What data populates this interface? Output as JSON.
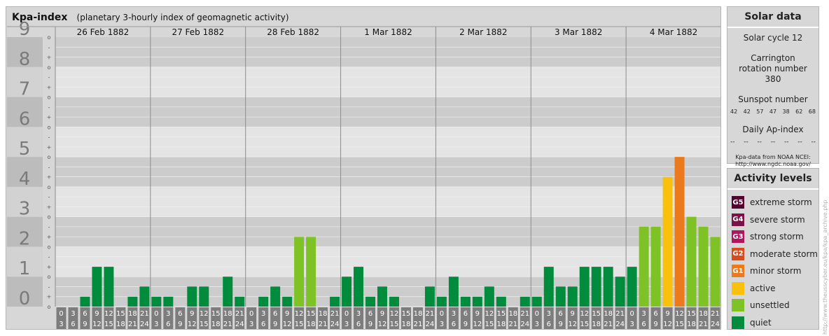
{
  "title": "Kpa-index",
  "subtitle": "(planetary 3-hourly index of geomagnetic activity)",
  "chart_data": {
    "type": "bar",
    "ylim": [
      0,
      9
    ],
    "y_ticks": [
      "0",
      "1",
      "2",
      "3",
      "4",
      "5",
      "6",
      "7",
      "8",
      "9"
    ],
    "sub_ticks": [
      "o",
      "+",
      "-"
    ],
    "days": [
      "26 Feb 1882",
      "27 Feb 1882",
      "28 Feb 1882",
      "1 Mar 1882",
      "2 Mar 1882",
      "3 Mar 1882",
      "4 Mar 1882"
    ],
    "interval_starts": [
      "0",
      "3",
      "6",
      "9",
      "12",
      "15",
      "18",
      "21"
    ],
    "interval_ends": [
      "3",
      "6",
      "9",
      "12",
      "15",
      "18",
      "21",
      "24"
    ],
    "values": [
      0,
      0,
      0.33,
      1.33,
      1.33,
      0,
      0.33,
      0.67,
      0.33,
      0.33,
      0,
      0.67,
      0.67,
      0,
      1,
      0.33,
      0,
      0.33,
      0.67,
      0.33,
      2.33,
      2.33,
      0,
      0.33,
      1,
      1.33,
      0.33,
      0.67,
      0.33,
      0,
      0,
      0.67,
      0.33,
      1,
      0.33,
      0.33,
      0.67,
      0.33,
      0,
      0.33,
      0.33,
      1.33,
      0.67,
      0.67,
      1.33,
      1.33,
      1.33,
      1,
      1.33,
      2.67,
      2.67,
      4.33,
      5,
      3,
      2.67,
      2.33
    ]
  },
  "solar_data": {
    "title": "Solar data",
    "solar_cycle": "Solar cycle 12",
    "carrington": "Carrington rotation number 380",
    "sunspot_label": "Sunspot number",
    "sunspot_values": [
      "42",
      "42",
      "57",
      "47",
      "38",
      "62",
      "68"
    ],
    "ap_label": "Daily Ap-index",
    "ap_values": [
      "--",
      "--",
      "--",
      "--",
      "--",
      "--",
      "--"
    ],
    "source_line1": "Kpa-data from NOAA NCEI:",
    "source_line2": "http://www.ngdc.noaa.gov/"
  },
  "activity_levels": {
    "title": "Activity levels",
    "items": [
      {
        "code": "G5",
        "label": "extreme storm",
        "color": "#52002e"
      },
      {
        "code": "G4",
        "label": "severe storm",
        "color": "#7a1245"
      },
      {
        "code": "G3",
        "label": "strong storm",
        "color": "#b0165e"
      },
      {
        "code": "G2",
        "label": "moderate storm",
        "color": "#dc4a1c"
      },
      {
        "code": "G1",
        "label": "minor storm",
        "color": "#eb7a1c"
      },
      {
        "code": "",
        "label": "active",
        "color": "#f9c10c"
      },
      {
        "code": "",
        "label": "unsettled",
        "color": "#7ec225"
      },
      {
        "code": "",
        "label": "quiet",
        "color": "#008c3c"
      }
    ]
  },
  "credit": "http://www.theusscyber.eu/kpa/kpa_archive.php"
}
